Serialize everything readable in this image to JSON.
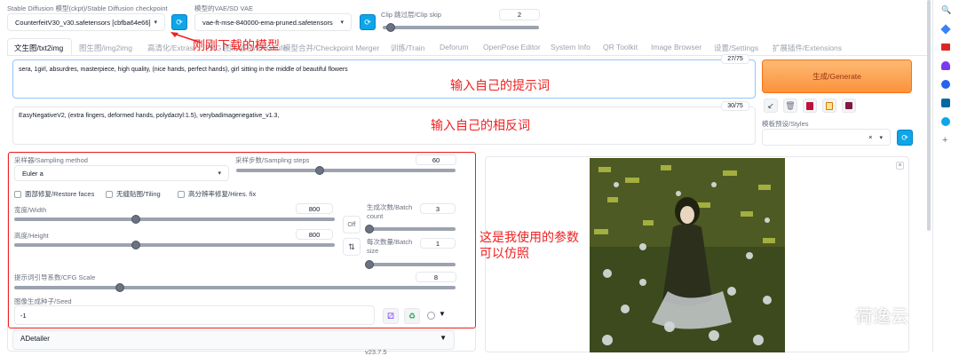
{
  "top": {
    "ckpt_label": "Stable Diffusion 模型(ckpt)/Stable Diffusion checkpoint",
    "ckpt_value": "CounterfeitV30_v30.safetensors [cbfba64e66]",
    "vae_label": "模型的VAE/SD VAE",
    "vae_value": "vae-ft-mse-840000-ema-pruned.safetensors",
    "clip_label": "Clip 跳过层/Clip skip",
    "clip_value": "2"
  },
  "tabs": [
    "文生图/txt2img",
    "图生图/img2img",
    "高清化/Extras",
    "PNG 图片信息/PNG Info",
    "模型合并/Checkpoint Merger",
    "训练/Train",
    "Deforum",
    "OpenPose Editor",
    "System Info",
    "QR Toolkit",
    "Image Browser",
    "设置/Settings",
    "扩展插件/Extensions"
  ],
  "prompt": {
    "text": "sera, 1girl, absurdres, masterpiece, high quality, (nice hands, perfect hands), girl sitting in the middle of beautiful flowers",
    "count": "27/75"
  },
  "negative": {
    "text": "EasyNegativeV2, (extra fingers, deformed hands, polydactyl:1.5),  verybadimagenegative_v1.3,",
    "count": "30/75"
  },
  "generate_label": "生成/Generate",
  "styles_label": "模板预设/Styles",
  "styles_clear": "×",
  "params": {
    "sampler_label": "采样器/Sampling method",
    "sampler_value": "Euler a",
    "steps_label": "采样步数/Sampling steps",
    "steps_value": "60",
    "restore_faces": "面部修复/Restore faces",
    "tiling": "无缝贴图/Tiling",
    "hires": "高分辨率修复/Hires. fix",
    "width_label": "宽度/Width",
    "width_value": "800",
    "height_label": "高度/Height",
    "height_value": "800",
    "swap_label": "Off",
    "batch_count_label": "生成次数/Batch count",
    "batch_count_value": "3",
    "batch_size_label": "每次数量/Batch size",
    "batch_size_value": "1",
    "cfg_label": "提示词引导系数/CFG Scale",
    "cfg_value": "8",
    "seed_label": "图像生成种子/Seed",
    "seed_value": "-1",
    "adetailer": "ADetailer",
    "adetailer_version": "v23.7.5"
  },
  "slider_levels": {
    "steps": 0.38,
    "width": 0.38,
    "height": 0.38,
    "batch_count": 0.02,
    "batch_size": 0.02,
    "cfg": 0.24,
    "clip": 0.05
  },
  "annotations": {
    "model_note": "刚刚下载的模型",
    "prompt_note": "输入自己的提示词",
    "negative_note": "输入自己的相反词",
    "params_note_1": "这是我使用的参数",
    "params_note_2": "可以仿照"
  },
  "watermark": "荷逸云",
  "colors": {
    "accent": "#f97316",
    "annotation": "#ef2020",
    "refresh": "#0ea5e9"
  }
}
